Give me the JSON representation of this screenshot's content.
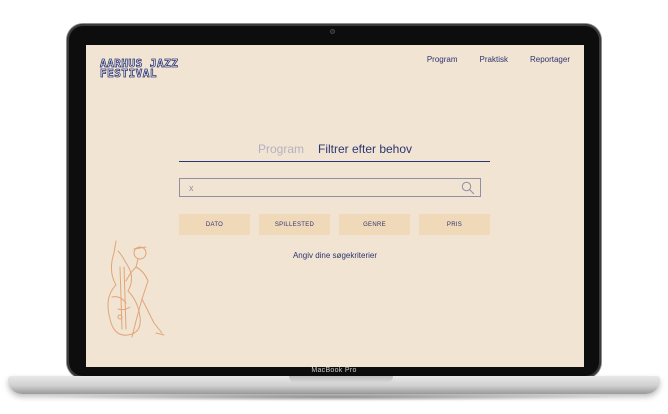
{
  "site": {
    "logo_line1": "AARHUS JAZZ",
    "logo_line2": "FESTIVAL",
    "nav": [
      "Program",
      "Praktisk",
      "Reportager"
    ]
  },
  "tabs": {
    "inactive": "Program",
    "active": "Filtrer efter behov"
  },
  "search": {
    "value": "x"
  },
  "filters": [
    "DATO",
    "SPILLESTED",
    "GENRE",
    "PRIS"
  ],
  "hint": "Angiv dine søgekriterier",
  "device": {
    "label": "MacBook Pro"
  },
  "colors": {
    "background": "#f2e4d2",
    "accent": "#2c3572",
    "filter_bg": "#f0d9b8",
    "illustration": "#e0a57a"
  }
}
